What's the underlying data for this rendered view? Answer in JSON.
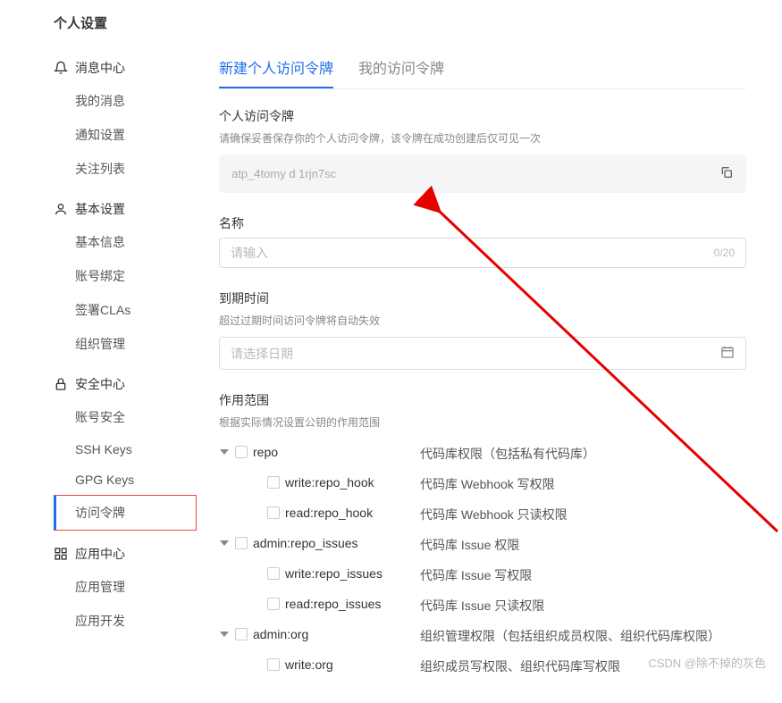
{
  "page": {
    "title": "个人设置"
  },
  "sidebar": {
    "groups": [
      {
        "icon": "bell",
        "label": "消息中心",
        "items": [
          "我的消息",
          "通知设置",
          "关注列表"
        ]
      },
      {
        "icon": "user",
        "label": "基本设置",
        "items": [
          "基本信息",
          "账号绑定",
          "签署CLAs",
          "组织管理"
        ]
      },
      {
        "icon": "lock",
        "label": "安全中心",
        "items": [
          "账号安全",
          "SSH Keys",
          "GPG Keys",
          "访问令牌"
        ]
      },
      {
        "icon": "apps",
        "label": "应用中心",
        "items": [
          "应用管理",
          "应用开发"
        ]
      }
    ],
    "active_item": "访问令牌"
  },
  "tabs": {
    "items": [
      "新建个人访问令牌",
      "我的访问令牌"
    ],
    "active_index": 0
  },
  "token_section": {
    "label": "个人访问令牌",
    "hint": "请确保妥善保存你的个人访问令牌，该令牌在成功创建后仅可见一次",
    "value": "atp_4tomy    d            1rjn7sc"
  },
  "name_section": {
    "label": "名称",
    "placeholder": "请输入",
    "count": "0/20"
  },
  "expire_section": {
    "label": "到期时间",
    "hint": "超过过期时间访问令牌将自动失效",
    "placeholder": "请选择日期"
  },
  "scope_section": {
    "label": "作用范围",
    "hint": "根据实际情况设置公钥的作用范围",
    "tree": [
      {
        "indent": 1,
        "toggle": true,
        "key": "repo",
        "desc": "代码库权限（包括私有代码库）"
      },
      {
        "indent": 2,
        "toggle": false,
        "key": "write:repo_hook",
        "desc": "代码库 Webhook 写权限"
      },
      {
        "indent": 2,
        "toggle": false,
        "key": "read:repo_hook",
        "desc": "代码库 Webhook 只读权限"
      },
      {
        "indent": 1,
        "toggle": true,
        "key": "admin:repo_issues",
        "desc": "代码库 Issue 权限"
      },
      {
        "indent": 2,
        "toggle": false,
        "key": "write:repo_issues",
        "desc": "代码库 Issue 写权限"
      },
      {
        "indent": 2,
        "toggle": false,
        "key": "read:repo_issues",
        "desc": "代码库 Issue 只读权限"
      },
      {
        "indent": 1,
        "toggle": true,
        "key": "admin:org",
        "desc": "组织管理权限（包括组织成员权限、组织代码库权限）"
      },
      {
        "indent": 2,
        "toggle": false,
        "key": "write:org",
        "desc": "组织成员写权限、组织代码库写权限"
      }
    ]
  },
  "watermark": "CSDN @除不掉的灰色"
}
